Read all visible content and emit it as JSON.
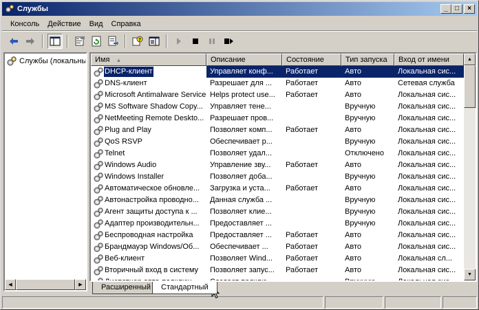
{
  "window": {
    "title": "Службы"
  },
  "titlebar_buttons": {
    "minimize": "_",
    "maximize": "□",
    "close": "×"
  },
  "menu": [
    "Консоль",
    "Действие",
    "Вид",
    "Справка"
  ],
  "toolbar": {
    "buttons": [
      "back-icon",
      "forward-icon",
      "show-tree-icon",
      "properties-icon",
      "refresh-icon",
      "export-list-icon",
      "help-icon",
      "show-action-pane-icon",
      "start-service-icon",
      "stop-service-icon",
      "pause-service-icon",
      "restart-service-icon"
    ]
  },
  "tree": {
    "root_label": "Службы (локальные)"
  },
  "columns": [
    "Имя",
    "Описание",
    "Состояние",
    "Тип запуска",
    "Вход от имени"
  ],
  "rows": [
    {
      "name": "DHCP-клиент",
      "desc": "Управляет конф...",
      "state": "Работает",
      "start": "Авто",
      "logon": "Локальная сис...",
      "selected": true
    },
    {
      "name": "DNS-клиент",
      "desc": "Разрешает для ...",
      "state": "Работает",
      "start": "Авто",
      "logon": "Сетевая служба"
    },
    {
      "name": "Microsoft Antimalware Service",
      "desc": "Helps protect use...",
      "state": "Работает",
      "start": "Авто",
      "logon": "Локальная сис..."
    },
    {
      "name": "MS Software Shadow Copy...",
      "desc": "Управляет тене...",
      "state": "",
      "start": "Вручную",
      "logon": "Локальная сис..."
    },
    {
      "name": "NetMeeting Remote Deskto...",
      "desc": "Разрешает пров...",
      "state": "",
      "start": "Вручную",
      "logon": "Локальная сис..."
    },
    {
      "name": "Plug and Play",
      "desc": "Позволяет комп...",
      "state": "Работает",
      "start": "Авто",
      "logon": "Локальная сис..."
    },
    {
      "name": "QoS RSVP",
      "desc": "Обеспечивает р...",
      "state": "",
      "start": "Вручную",
      "logon": "Локальная сис..."
    },
    {
      "name": "Telnet",
      "desc": "Позволяет удал...",
      "state": "",
      "start": "Отключено",
      "logon": "Локальная сис..."
    },
    {
      "name": "Windows Audio",
      "desc": "Управление зву...",
      "state": "Работает",
      "start": "Авто",
      "logon": "Локальная сис..."
    },
    {
      "name": "Windows Installer",
      "desc": "Позволяет доба...",
      "state": "",
      "start": "Вручную",
      "logon": "Локальная сис..."
    },
    {
      "name": "Автоматическое обновле...",
      "desc": "Загрузка и уста...",
      "state": "Работает",
      "start": "Авто",
      "logon": "Локальная сис..."
    },
    {
      "name": "Автонастройка проводно...",
      "desc": "Данная служба ...",
      "state": "",
      "start": "Вручную",
      "logon": "Локальная сис..."
    },
    {
      "name": "Агент защиты доступа к ...",
      "desc": "Позволяет клие...",
      "state": "",
      "start": "Вручную",
      "logon": "Локальная сис..."
    },
    {
      "name": "Адаптер производительн...",
      "desc": "Предоставляет ...",
      "state": "",
      "start": "Вручную",
      "logon": "Локальная сис..."
    },
    {
      "name": "Беспроводная настройка",
      "desc": "Предоставляет ...",
      "state": "Работает",
      "start": "Авто",
      "logon": "Локальная сис..."
    },
    {
      "name": "Брандмауэр Windows/Об...",
      "desc": "Обеспечивает ...",
      "state": "Работает",
      "start": "Авто",
      "logon": "Локальная сис..."
    },
    {
      "name": "Веб-клиент",
      "desc": "Позволяет Wind...",
      "state": "Работает",
      "start": "Авто",
      "logon": "Локальная сл..."
    },
    {
      "name": "Вторичный вход в систему",
      "desc": "Позволяет запус...",
      "state": "Работает",
      "start": "Авто",
      "logon": "Локальная сис..."
    },
    {
      "name": "Диспетчер авто-подключ...",
      "desc": "Создает подклю...",
      "state": "",
      "start": "Вручную",
      "logon": "Локальная сис..."
    }
  ],
  "tabs": [
    "Расширенный",
    "Стандартный"
  ],
  "active_tab": "Стандартный",
  "colors": {
    "title_gradient_start": "#0a246a",
    "title_gradient_end": "#a6caf0",
    "selection": "#0a246a",
    "face": "#d4d0c8"
  }
}
